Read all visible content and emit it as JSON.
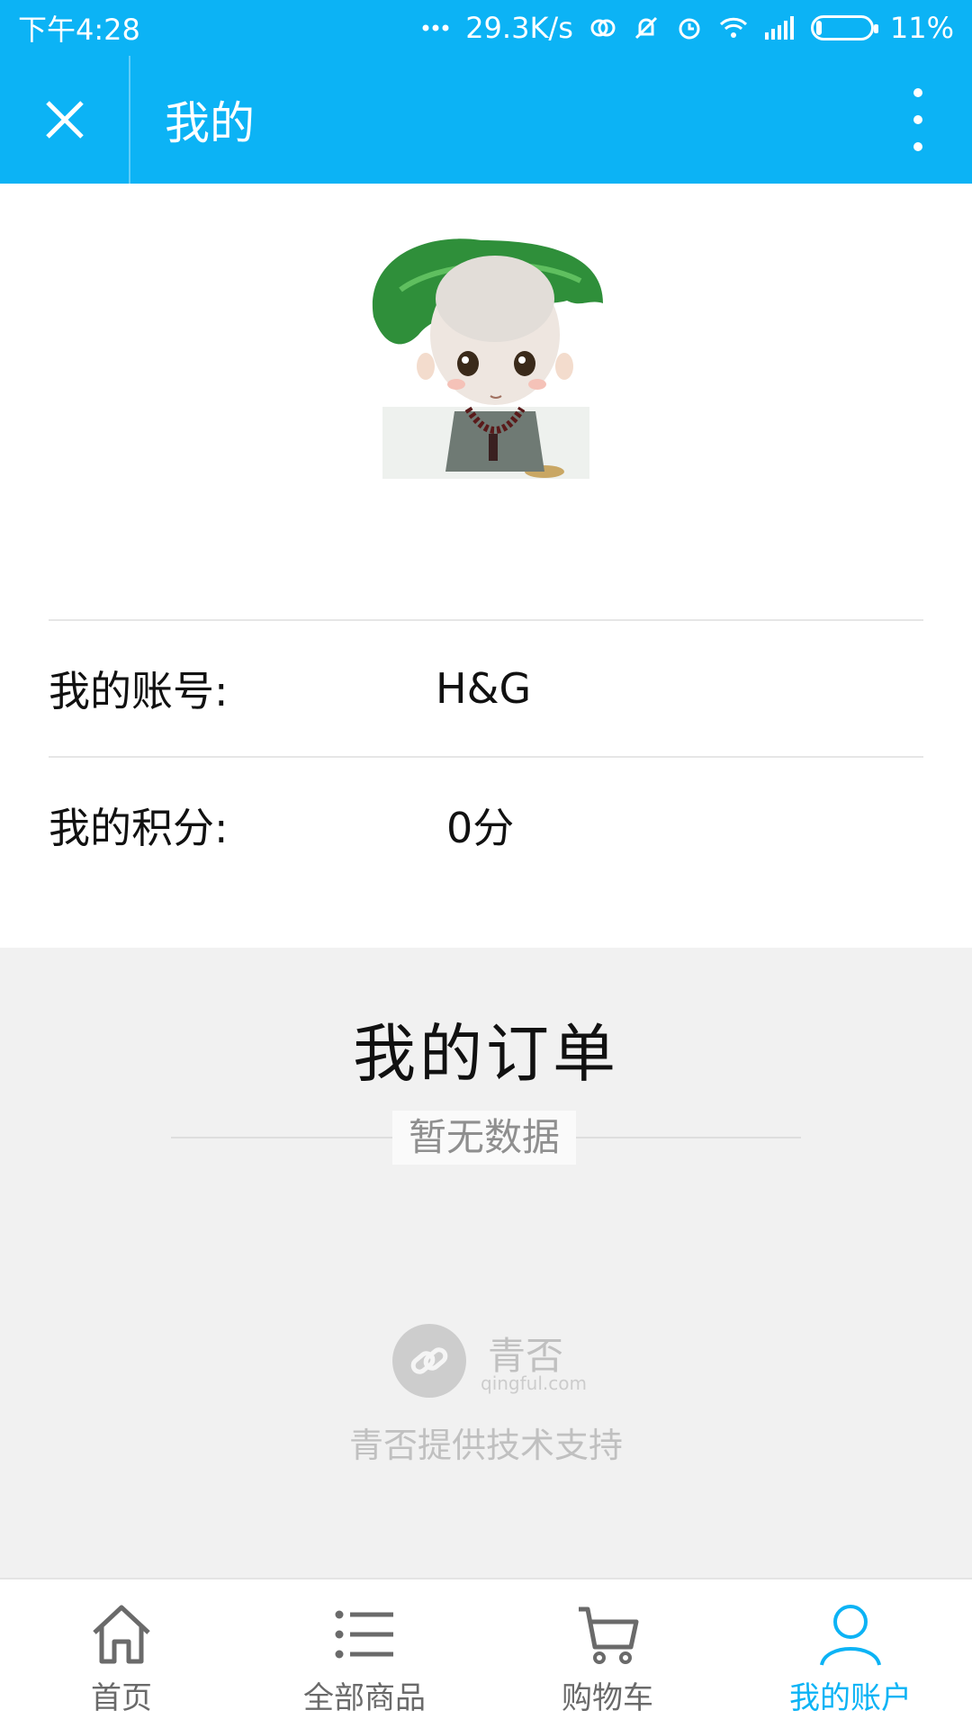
{
  "status_bar": {
    "time": "下午4:28",
    "network_speed": "29.3K/s",
    "battery_percent": "11%",
    "battery_level": 0.11,
    "icons": [
      "more-dots-icon",
      "hd-link-icon",
      "mute-icon",
      "alarm-icon",
      "wifi-icon",
      "signal-icon",
      "battery-icon"
    ]
  },
  "nav": {
    "title": "我的",
    "close_icon": "close-icon",
    "more_icon": "more-vertical-icon"
  },
  "profile": {
    "account_label": "我的账号:",
    "account_value": "H&G",
    "points_label": "我的积分:",
    "points_value": "0分"
  },
  "orders": {
    "title": "我的订单",
    "empty_text": "暂无数据"
  },
  "brand": {
    "name": "青否",
    "domain": "qingful.com",
    "support_text": "青否提供技术支持"
  },
  "tabs": [
    {
      "label": "首页",
      "icon": "home-icon",
      "active": false
    },
    {
      "label": "全部商品",
      "icon": "list-icon",
      "active": false
    },
    {
      "label": "购物车",
      "icon": "cart-icon",
      "active": false
    },
    {
      "label": "我的账户",
      "icon": "user-icon",
      "active": true
    }
  ],
  "colors": {
    "primary": "#0cb3f5",
    "background_gray": "#f1f1f1",
    "text_dark": "#111111",
    "text_muted": "#8f8f8f"
  }
}
